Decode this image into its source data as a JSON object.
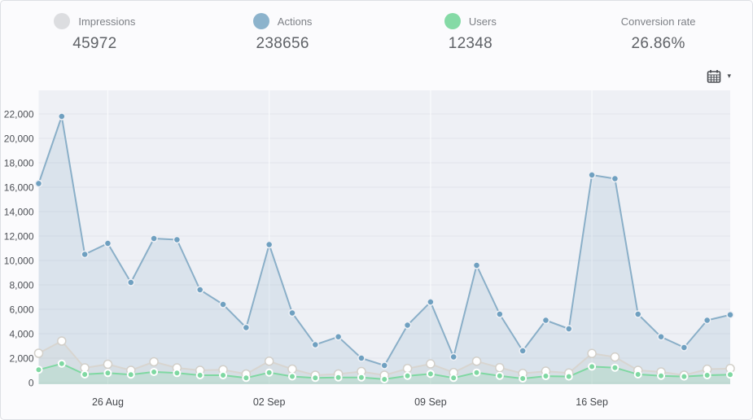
{
  "header": {
    "stats": [
      {
        "label": "Impressions",
        "value": "45972",
        "dot_color": "#dcdde0"
      },
      {
        "label": "Actions",
        "value": "238656",
        "dot_color": "#8cb3cc"
      },
      {
        "label": "Users",
        "value": "12348",
        "dot_color": "#85daa6"
      },
      {
        "label": "Conversion rate",
        "value": "26.86%",
        "dot_color": null
      }
    ],
    "date_picker": {
      "icon": "calendar-icon",
      "caret": "▾"
    }
  },
  "chart_data": {
    "type": "line",
    "title": "",
    "xlabel": "",
    "ylabel": "",
    "n_points": 31,
    "x_tick_labels": [
      "26 Aug",
      "02 Sep",
      "09 Sep",
      "16 Sep"
    ],
    "x_tick_indices": [
      3,
      10,
      17,
      24
    ],
    "yticks": [
      0,
      2000,
      4000,
      6000,
      8000,
      10000,
      12000,
      14000,
      16000,
      18000,
      20000,
      22000
    ],
    "ylim": [
      0,
      23900
    ],
    "grid": true,
    "legend_position": "top-header",
    "plot_bg": "#eef0f5",
    "h_grid_color": "#e2e5ea",
    "v_grid_color": "#fafbfd",
    "series": [
      {
        "name": "Actions",
        "line_color": "#8aafc8",
        "dot_color": "#6fa0c0",
        "dot_stroke": "#eef0f5",
        "fill": "rgba(138,175,200,0.20)",
        "values": [
          16300,
          21800,
          10500,
          11400,
          8200,
          11800,
          11700,
          7600,
          6400,
          4500,
          11300,
          5700,
          3100,
          3750,
          2000,
          1400,
          4700,
          6600,
          2100,
          9600,
          5600,
          2600,
          5100,
          4400,
          17000,
          16700,
          5600,
          3750,
          2870,
          5100,
          5550
        ]
      },
      {
        "name": "Impressions",
        "line_color": "#d8d5d0",
        "dot_color": "#ffffff",
        "dot_stroke": "#d2cfc9",
        "fill": "rgba(200,198,194,0.18)",
        "values": [
          2400,
          3400,
          1200,
          1500,
          1000,
          1700,
          1200,
          1000,
          1050,
          700,
          1750,
          1100,
          600,
          700,
          900,
          600,
          1150,
          1530,
          820,
          1750,
          1220,
          750,
          930,
          780,
          2380,
          2090,
          1000,
          870,
          600,
          1090,
          1150
        ]
      },
      {
        "name": "Users",
        "line_color": "#7fd8a2",
        "dot_color": "#7fd8a2",
        "dot_stroke": "#ffffff",
        "fill": "rgba(127,216,162,0.22)",
        "values": [
          1050,
          1550,
          670,
          780,
          650,
          870,
          780,
          600,
          600,
          380,
          820,
          500,
          380,
          420,
          420,
          270,
          550,
          710,
          380,
          820,
          550,
          330,
          530,
          490,
          1310,
          1220,
          670,
          550,
          490,
          600,
          650
        ]
      }
    ]
  }
}
